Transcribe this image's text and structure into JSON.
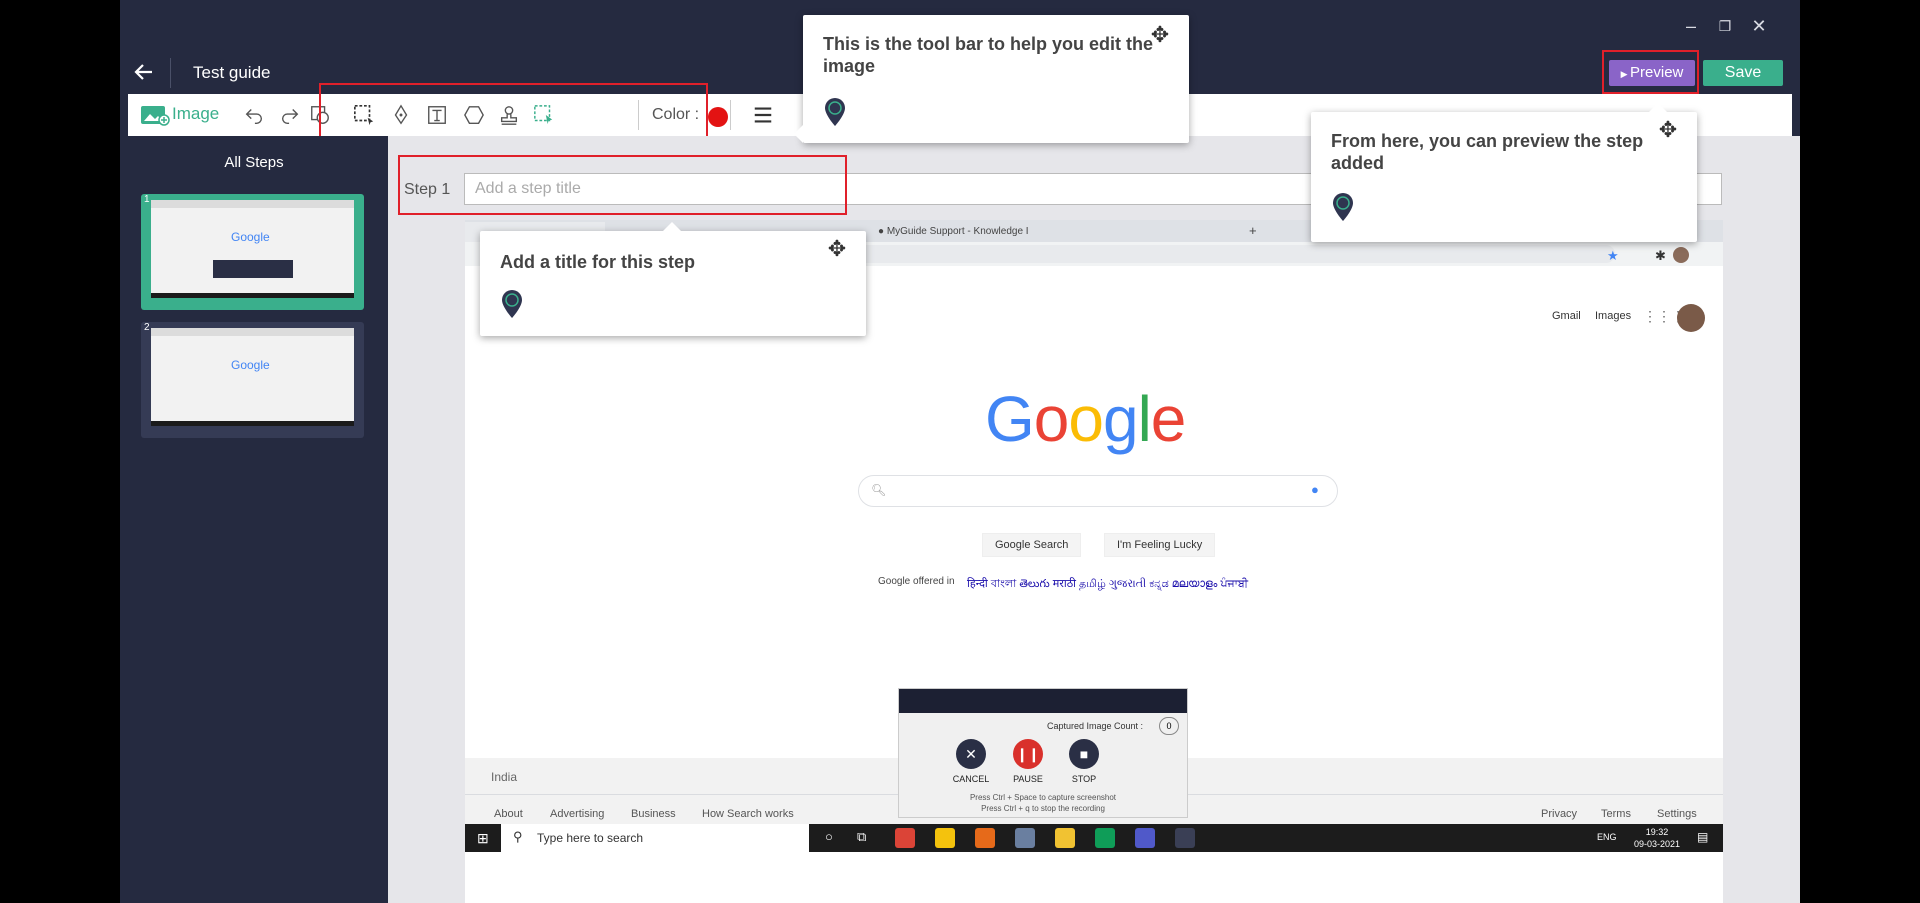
{
  "header": {
    "back_icon": "arrow-left-icon",
    "title": "Test guide",
    "preview_label": "Preview",
    "save_label": "Save"
  },
  "window_controls": {
    "minimize": "–",
    "restore": "❐",
    "close": "✕"
  },
  "toolbar": {
    "image_label": "Image",
    "color_label": "Color :",
    "color_value": "#e31313",
    "tools": [
      "undo-icon",
      "redo-icon",
      "shapes-icon",
      "crop-select-icon",
      "pen-icon",
      "text-box-icon",
      "polygon-icon",
      "stamp-icon",
      "magic-select-icon"
    ]
  },
  "sidebar": {
    "title": "All Steps",
    "steps": [
      {
        "number": "1",
        "selected": true
      },
      {
        "number": "2",
        "selected": false
      }
    ]
  },
  "step": {
    "label": "Step 1",
    "title_placeholder": "Add a step title"
  },
  "popups": {
    "toolbar_hint": "This is the tool bar to help you edit the image",
    "title_hint": "Add a title for this step",
    "preview_hint": "From here, you can preview the step added"
  },
  "screenshot": {
    "tab_text": "MyGuide Support - Knowledge I",
    "tab_add": "+",
    "gmail": "Gmail",
    "images": "Images",
    "logo": "Google",
    "search_button": "Google Search",
    "lucky_button": "I'm Feeling Lucky",
    "offered_in": "Google offered in",
    "languages": "हिन्दी  বাংলা  తెలుగు  मराठी  தமிழ்  ગુજરાતી  ಕನ್ನಡ  മലയാളം  ਪੰਜਾਬੀ",
    "country": "India",
    "footer_left": [
      "About",
      "Advertising",
      "Business",
      "How Search works"
    ],
    "footer_right": [
      "Privacy",
      "Terms",
      "Settings"
    ],
    "recorder": {
      "count_label": "Captured Image Count :",
      "count": "0",
      "cancel": "CANCEL",
      "pause": "PAUSE",
      "stop": "STOP",
      "hint1": "Press Ctrl + Space to capture screenshot",
      "hint2": "Press Ctrl + q to stop the recording"
    },
    "taskbar": {
      "search_placeholder": "Type here to search",
      "lang": "ENG",
      "time": "19:32",
      "date": "09-03-2021"
    }
  }
}
